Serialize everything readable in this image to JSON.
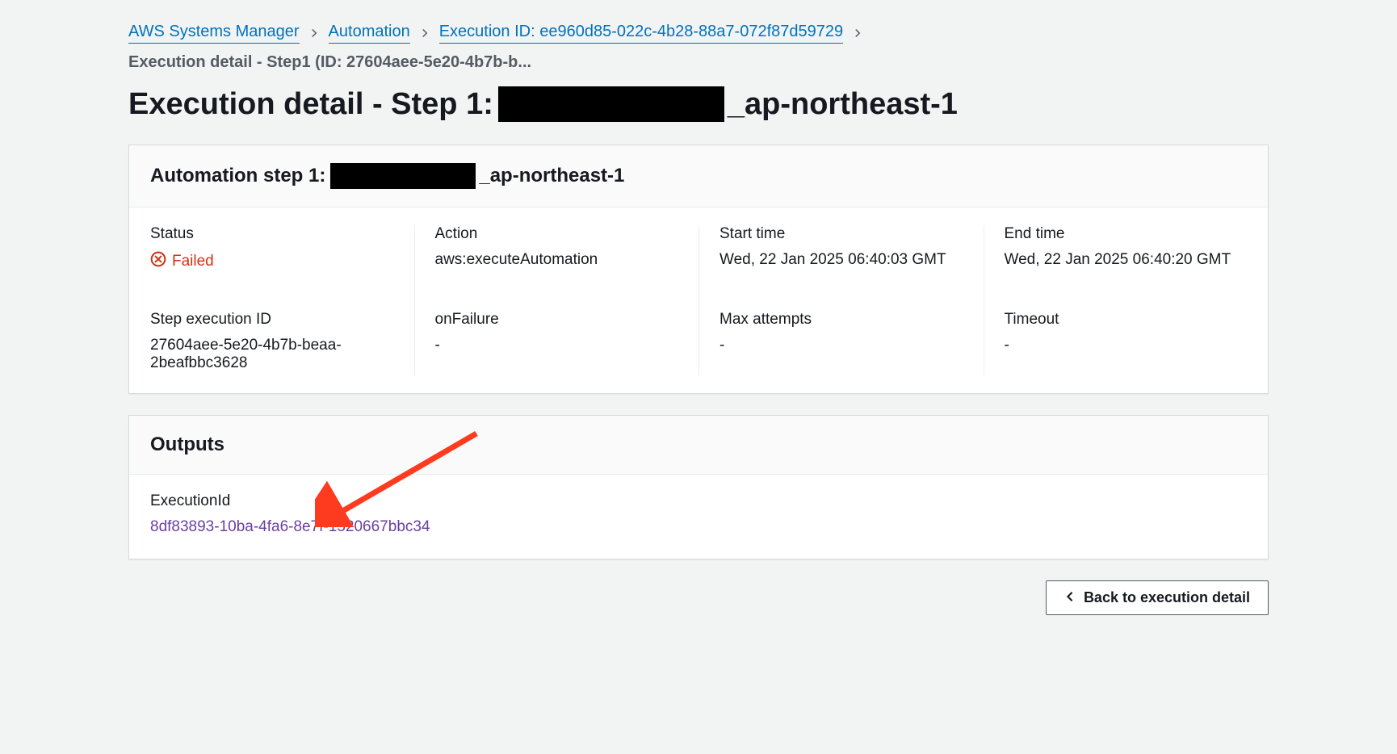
{
  "breadcrumb": {
    "items": [
      {
        "label": "AWS Systems Manager"
      },
      {
        "label": "Automation"
      },
      {
        "label": "Execution ID: ee960d85-022c-4b28-88a7-072f87d59729"
      }
    ],
    "current": "Execution detail - Step1 (ID: 27604aee-5e20-4b7b-b..."
  },
  "page_title": {
    "prefix": "Execution detail - Step 1: ",
    "suffix": "_ap-northeast-1"
  },
  "step_panel": {
    "header_prefix": "Automation step 1: ",
    "header_suffix": "_ap-northeast-1",
    "fields": {
      "status_label": "Status",
      "status_value": "Failed",
      "action_label": "Action",
      "action_value": "aws:executeAutomation",
      "start_time_label": "Start time",
      "start_time_value": "Wed, 22 Jan 2025 06:40:03 GMT",
      "end_time_label": "End time",
      "end_time_value": "Wed, 22 Jan 2025 06:40:20 GMT",
      "step_exec_id_label": "Step execution ID",
      "step_exec_id_value": "27604aee-5e20-4b7b-beaa-2beafbbc3628",
      "on_failure_label": "onFailure",
      "on_failure_value": "-",
      "max_attempts_label": "Max attempts",
      "max_attempts_value": "-",
      "timeout_label": "Timeout",
      "timeout_value": "-"
    }
  },
  "outputs_panel": {
    "header": "Outputs",
    "execution_id_label": "ExecutionId",
    "execution_id_value": "8df83893-10ba-4fa6-8e7f-1520667bbc34"
  },
  "back_button": "Back to execution detail"
}
